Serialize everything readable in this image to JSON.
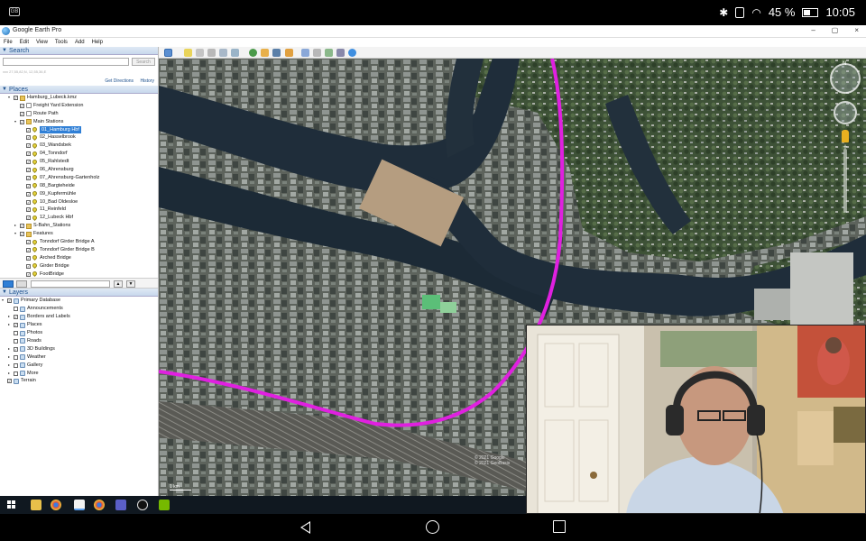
{
  "status_bar": {
    "app_chip": "GB",
    "battery_text": "45 %",
    "time": "10:05"
  },
  "window": {
    "title": "Google Earth Pro",
    "buttons": [
      "–",
      "▢",
      "×"
    ]
  },
  "menu": [
    "File",
    "Edit",
    "View",
    "Tools",
    "Add",
    "Help"
  ],
  "search": {
    "header": "Search",
    "input_value": "",
    "button_label": "Search",
    "coords_text": "xxx 27,55,82,N, 12,55,36,E",
    "links": [
      "Get Directions",
      "History"
    ]
  },
  "places": {
    "header": "Places",
    "items": [
      {
        "label": "Hamburg_Lubeck.kmz",
        "level": 1,
        "icon": "folder",
        "exp": "▾",
        "checked": true
      },
      {
        "label": "Freight Yard Extension",
        "level": 2,
        "icon": "path",
        "exp": "",
        "checked": true
      },
      {
        "label": "Route Path",
        "level": 2,
        "icon": "path",
        "exp": "",
        "checked": true
      },
      {
        "label": "Main Stations",
        "level": 2,
        "icon": "folder",
        "exp": "▾",
        "checked": true
      },
      {
        "label": "01_Hamburg Hbf",
        "level": 3,
        "icon": "pin",
        "exp": "",
        "checked": true,
        "selected": true
      },
      {
        "label": "02_Hasselbrook",
        "level": 3,
        "icon": "pin",
        "exp": "",
        "checked": true
      },
      {
        "label": "03_Wandsbek",
        "level": 3,
        "icon": "pin",
        "exp": "",
        "checked": true
      },
      {
        "label": "04_Tonndorf",
        "level": 3,
        "icon": "pin",
        "exp": "",
        "checked": true
      },
      {
        "label": "05_Rahlstedt",
        "level": 3,
        "icon": "pin",
        "exp": "",
        "checked": true
      },
      {
        "label": "06_Ahrensburg",
        "level": 3,
        "icon": "pin",
        "exp": "",
        "checked": true
      },
      {
        "label": "07_Ahrensburg-Gartenholz",
        "level": 3,
        "icon": "pin",
        "exp": "",
        "checked": true
      },
      {
        "label": "08_Bargteheide",
        "level": 3,
        "icon": "pin",
        "exp": "",
        "checked": true
      },
      {
        "label": "09_Kupfermühle",
        "level": 3,
        "icon": "pin",
        "exp": "",
        "checked": true
      },
      {
        "label": "10_Bad Oldesloe",
        "level": 3,
        "icon": "pin",
        "exp": "",
        "checked": true
      },
      {
        "label": "11_Reinfeld",
        "level": 3,
        "icon": "pin",
        "exp": "",
        "checked": true
      },
      {
        "label": "12_Lubeck Hbf",
        "level": 3,
        "icon": "pin",
        "exp": "",
        "checked": true
      },
      {
        "label": "S-Bahn_Stations",
        "level": 2,
        "icon": "folder",
        "exp": "▸",
        "checked": true
      },
      {
        "label": "Features",
        "level": 2,
        "icon": "folder",
        "exp": "▾",
        "checked": true
      },
      {
        "label": "Tonndorf Girder Bridge A",
        "level": 3,
        "icon": "pin",
        "exp": "",
        "checked": true
      },
      {
        "label": "Tonndorf Girder Bridge B",
        "level": 3,
        "icon": "pin",
        "exp": "",
        "checked": true
      },
      {
        "label": "Arched Bridge",
        "level": 3,
        "icon": "pin",
        "exp": "",
        "checked": true
      },
      {
        "label": "Girder Bridge",
        "level": 3,
        "icon": "pin",
        "exp": "",
        "checked": true
      },
      {
        "label": "FootBridge",
        "level": 3,
        "icon": "pin",
        "exp": "",
        "checked": true
      }
    ]
  },
  "layers": {
    "header": "Layers",
    "items": [
      {
        "label": "Primary Database",
        "level": 0,
        "icon": "db",
        "exp": "▾",
        "checked": true
      },
      {
        "label": "Announcements",
        "level": 1,
        "icon": "db",
        "exp": "",
        "checked": false
      },
      {
        "label": "Borders and Labels",
        "level": 1,
        "icon": "db",
        "exp": "▸",
        "checked": true
      },
      {
        "label": "Places",
        "level": 1,
        "icon": "db",
        "exp": "▸",
        "checked": true
      },
      {
        "label": "Photos",
        "level": 1,
        "icon": "db",
        "exp": "",
        "checked": false
      },
      {
        "label": "Roads",
        "level": 1,
        "icon": "db",
        "exp": "",
        "checked": false
      },
      {
        "label": "3D Buildings",
        "level": 1,
        "icon": "db",
        "exp": "▸",
        "checked": true
      },
      {
        "label": "Weather",
        "level": 1,
        "icon": "db",
        "exp": "▸",
        "checked": false
      },
      {
        "label": "Gallery",
        "level": 1,
        "icon": "db",
        "exp": "▸",
        "checked": false
      },
      {
        "label": "More",
        "level": 1,
        "icon": "db",
        "exp": "▸",
        "checked": false
      },
      {
        "label": "Terrain",
        "level": 0,
        "icon": "db",
        "exp": "",
        "checked": true
      }
    ]
  },
  "map": {
    "copyright": "© 2021 Google\n© 2021 GeoBasis",
    "scale": "1 km",
    "nav_north": "N",
    "zoom_plus": "+",
    "zoom_minus": "−",
    "route_color": "#e020e0",
    "water_color": "#1f2d3a"
  },
  "taskbar": {
    "icons": [
      "start-icon",
      "search-icon",
      "file-explorer-icon",
      "chrome-icon",
      "document-icon",
      "chrome-icon",
      "teams-icon",
      "unreal-icon",
      "nvidia-icon"
    ]
  }
}
